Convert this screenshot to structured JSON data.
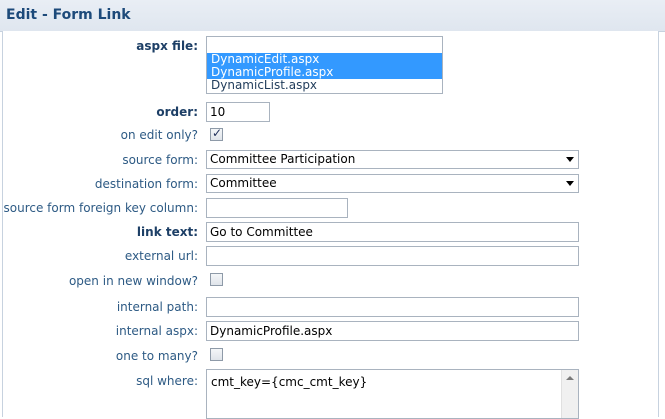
{
  "header": {
    "title": "Edit - Form Link"
  },
  "fields": {
    "aspx_file": {
      "label": "aspx file:",
      "options": [
        "DynamicEdit.aspx",
        "DynamicProfile.aspx",
        "DynamicList.aspx"
      ]
    },
    "order": {
      "label": "order:",
      "value": "10"
    },
    "on_edit_only": {
      "label": "on edit only?",
      "checked": true
    },
    "source_form": {
      "label": "source form:",
      "value": "Committee Participation"
    },
    "destination_form": {
      "label": "destination form:",
      "value": "Committee"
    },
    "source_form_fk": {
      "label": "source form foreign key column:",
      "value": ""
    },
    "link_text": {
      "label": "link text:",
      "value": "Go to Committee"
    },
    "external_url": {
      "label": "external url:",
      "value": ""
    },
    "open_new_window": {
      "label": "open in new window?",
      "checked": false
    },
    "internal_path": {
      "label": "internal path:",
      "value": ""
    },
    "internal_aspx": {
      "label": "internal aspx:",
      "value": "DynamicProfile.aspx"
    },
    "one_to_many": {
      "label": "one to many?",
      "checked": false
    },
    "sql_where": {
      "label": "sql where:",
      "value": "cmt_key={cmc_cmt_key}"
    }
  },
  "icons": {
    "checkbox_check": "check-icon",
    "dropdown": "chevron-down-icon",
    "scroll_up": "arrow-up-icon"
  },
  "colors": {
    "selection": "#3399ff",
    "label": "#2d5a84",
    "title": "#1d4a7a"
  }
}
